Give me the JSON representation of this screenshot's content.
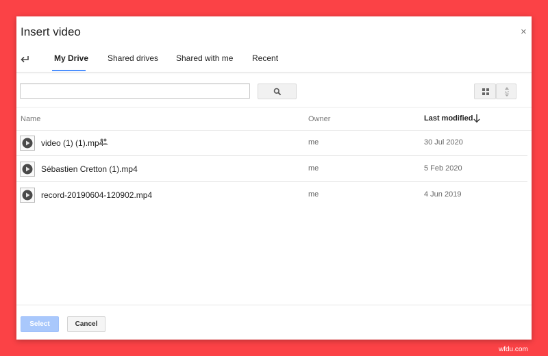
{
  "dialog": {
    "title": "Insert video",
    "close_glyph": "×"
  },
  "tabs": [
    {
      "label": "My Drive",
      "active": true
    },
    {
      "label": "Shared drives",
      "active": false
    },
    {
      "label": "Shared with me",
      "active": false
    },
    {
      "label": "Recent",
      "active": false
    }
  ],
  "search": {
    "value": "",
    "placeholder": ""
  },
  "table": {
    "headers": {
      "name": "Name",
      "owner": "Owner",
      "last_modified": "Last modified"
    },
    "rows": [
      {
        "name": "video (1) (1).mp4",
        "shared": true,
        "owner": "me",
        "modified": "30 Jul 2020"
      },
      {
        "name": "Sébastien Cretton (1).mp4",
        "shared": false,
        "owner": "me",
        "modified": "5 Feb 2020"
      },
      {
        "name": "record-20190604-120902.mp4",
        "shared": false,
        "owner": "me",
        "modified": "4 Jun 2019"
      }
    ]
  },
  "footer": {
    "select_label": "Select",
    "cancel_label": "Cancel"
  },
  "watermark": "wfdu.com",
  "icons": {
    "back": "back-arrow-icon",
    "search": "search-icon",
    "grid": "grid-view-icon",
    "sort": "sort-icon",
    "sort_direction": "arrow-down-icon",
    "shared": "people-icon",
    "video": "play-circle-icon"
  },
  "colors": {
    "background": "#fb4246",
    "accent": "#4d90fe",
    "select_button": "#a9c8fc"
  }
}
